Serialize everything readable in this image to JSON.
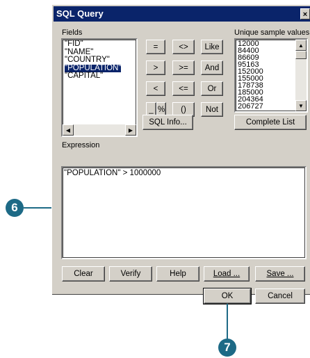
{
  "dialog": {
    "title": "SQL Query",
    "close_glyph": "×"
  },
  "fields": {
    "label": "Fields",
    "items": [
      "\"FID\"",
      "\"NAME\"",
      "\"COUNTRY\"",
      "\"POPULATION\"",
      "\"CAPITAL\""
    ],
    "selected": "\"POPULATION\""
  },
  "operators": {
    "row1": [
      "=",
      "<>",
      "Like"
    ],
    "row2": [
      ">",
      ">=",
      "And"
    ],
    "row3": [
      "<",
      "<=",
      "Or"
    ],
    "row4": [
      "_",
      "%",
      "()",
      "Not"
    ]
  },
  "unique_values": {
    "label": "Unique sample values",
    "items": [
      "12000",
      "84400",
      "86609",
      "95163",
      "152000",
      "155000",
      "178738",
      "185000",
      "204364",
      "206727"
    ]
  },
  "buttons": {
    "sql_info": "SQL Info...",
    "complete_list": "Complete List",
    "clear": "Clear",
    "verify": "Verify",
    "help": "Help",
    "load": "Load ...",
    "save": "Save ...",
    "ok": "OK",
    "cancel": "Cancel"
  },
  "expression": {
    "label": "Expression",
    "value": "\"POPULATION\" > 1000000"
  },
  "callouts": {
    "step6": "6",
    "step7": "7"
  },
  "colors": {
    "titlebar": "#0a246a",
    "dialog_face": "#d4d0c8",
    "callout": "#1d6a86"
  }
}
